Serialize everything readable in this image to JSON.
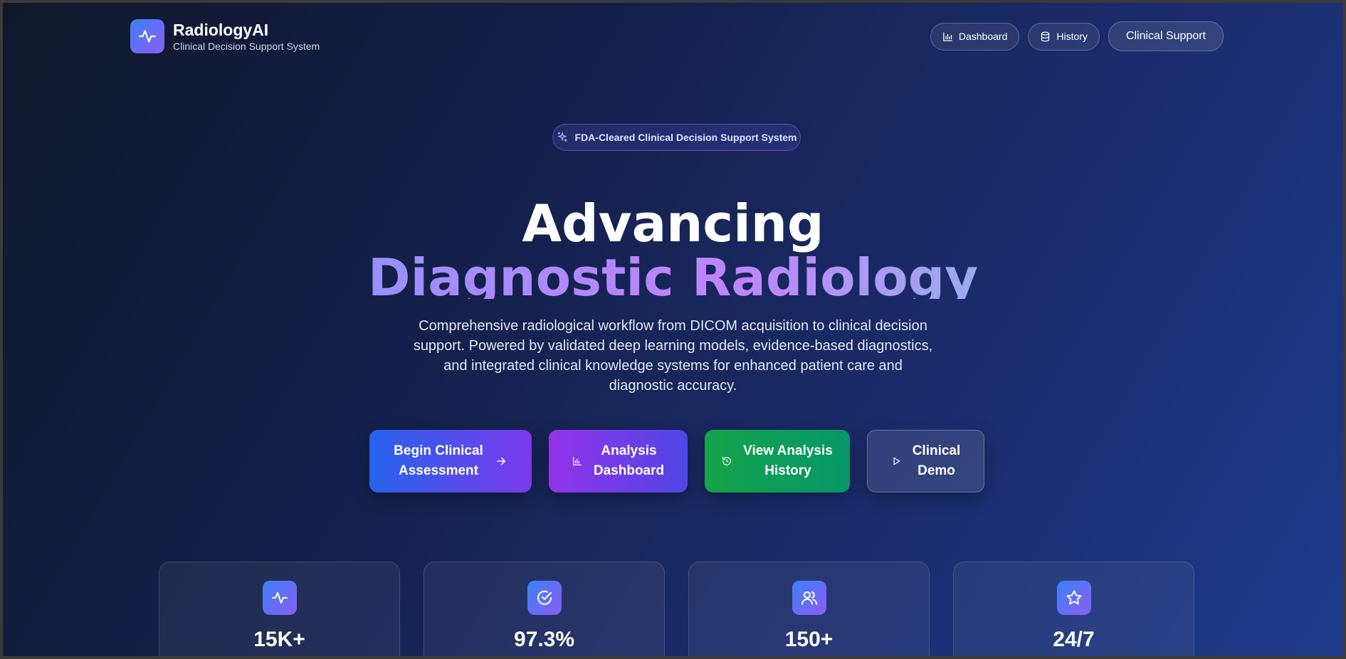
{
  "header": {
    "brand_title": "RadiologyAI",
    "brand_subtitle": "Clinical Decision Support System",
    "nav": [
      {
        "label": "Dashboard",
        "icon": "bar-chart-icon"
      },
      {
        "label": "History",
        "icon": "database-icon"
      },
      {
        "label": "Clinical Support"
      }
    ]
  },
  "badge": {
    "label": "FDA-Cleared Clinical Decision Support System",
    "icon": "sparkles-icon"
  },
  "hero": {
    "title_line1": "Advancing",
    "title_line2": "Diagnostic Radiology",
    "description": "Comprehensive radiological workflow from DICOM acquisition to clinical decision support. Powered by validated deep learning models, evidence-based diagnostics, and integrated clinical knowledge systems for enhanced patient care and diagnostic accuracy."
  },
  "cta": [
    {
      "line1": "Begin Clinical",
      "line2": "Assessment",
      "icon": "arrow-right-icon"
    },
    {
      "line1": "Analysis",
      "line2": "Dashboard",
      "icon": "bar-chart-icon"
    },
    {
      "line1": "View Analysis",
      "line2": "History",
      "icon": "history-icon"
    },
    {
      "line1": "Clinical",
      "line2": "Demo",
      "icon": "play-icon"
    }
  ],
  "stats": [
    {
      "value": "15K+",
      "icon": "activity-icon"
    },
    {
      "value": "97.3%",
      "icon": "check-circle-icon"
    },
    {
      "value": "150+",
      "icon": "users-icon"
    },
    {
      "value": "24/7",
      "icon": "star-icon"
    }
  ],
  "colors": {
    "accent_blue": "#3b82f6",
    "accent_purple": "#8b5cf6",
    "green": "#16a34a",
    "background": "#14204a"
  }
}
